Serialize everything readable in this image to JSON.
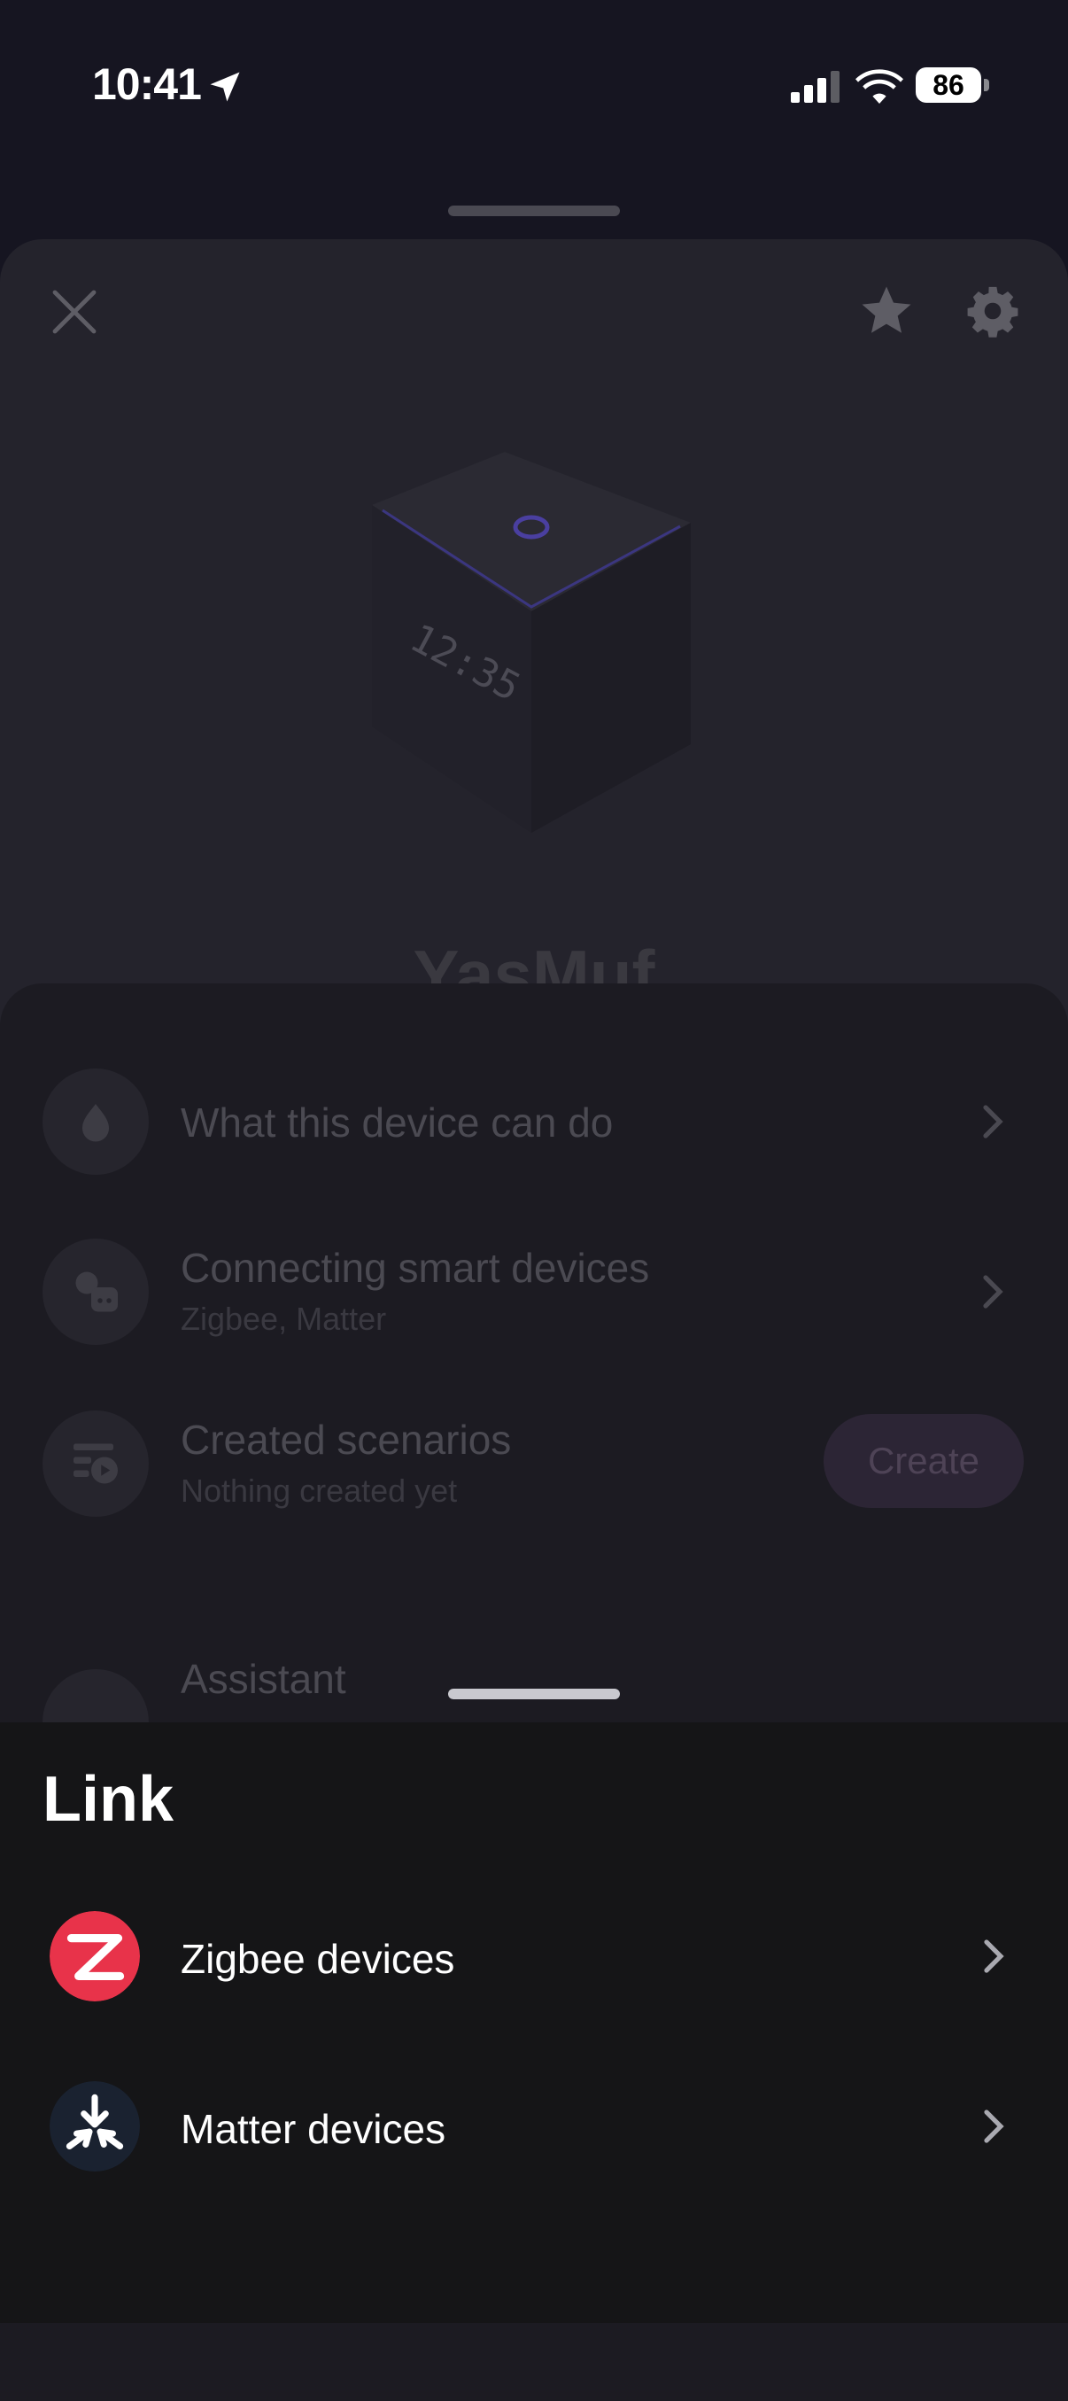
{
  "status_bar": {
    "time": "10:41",
    "battery": "86"
  },
  "device": {
    "name": "YasMuf",
    "display_clock": "12:35"
  },
  "menu": {
    "capabilities": {
      "title": "What this device can do"
    },
    "connecting": {
      "title": "Connecting smart devices",
      "subtitle": "Zigbee, Matter"
    },
    "scenarios": {
      "title": "Created scenarios",
      "subtitle": "Nothing created yet",
      "button": "Create"
    },
    "assistant": {
      "title": "Assistant"
    }
  },
  "link_sheet": {
    "title": "Link",
    "items": [
      {
        "label": "Zigbee devices",
        "icon": "zigbee-logo-icon"
      },
      {
        "label": "Matter devices",
        "icon": "matter-logo-icon"
      }
    ]
  },
  "colors": {
    "background": "#161521",
    "sheet": "#151517",
    "zigbee": "#e8334a",
    "matter_bg": "#1a2230"
  }
}
